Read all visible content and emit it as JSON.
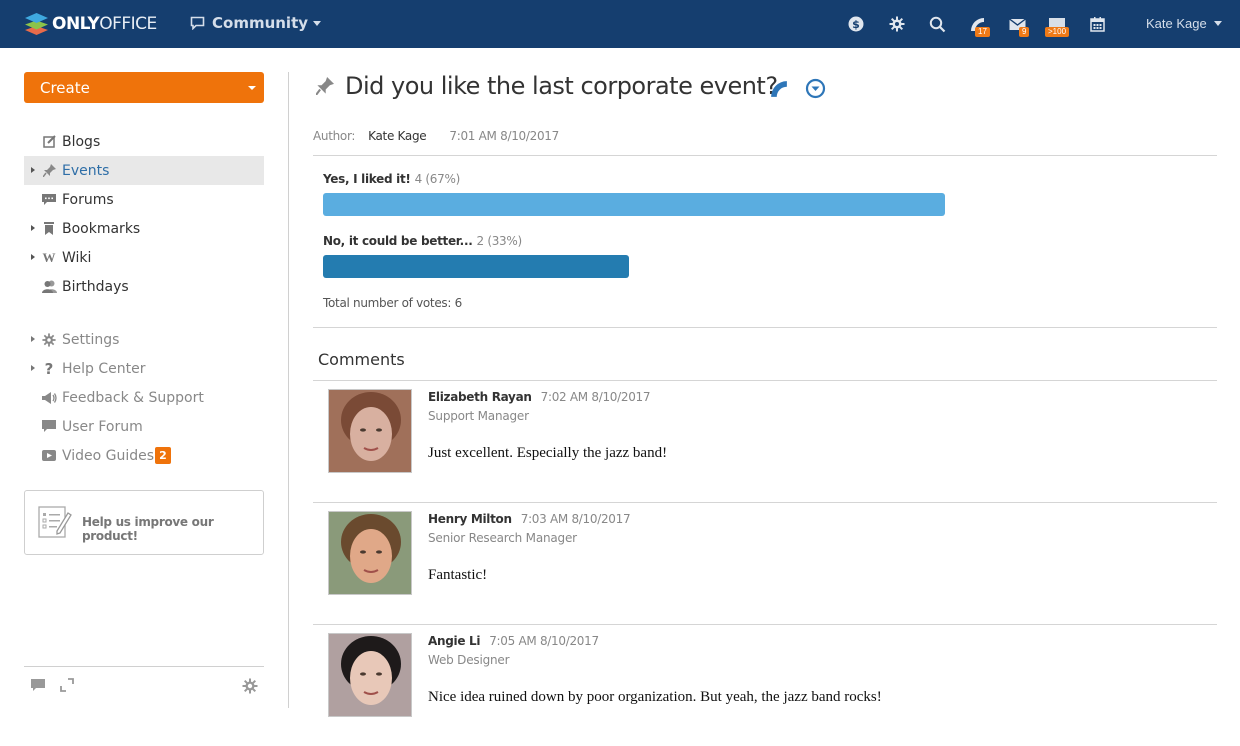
{
  "header": {
    "logo_bold": "ONLY",
    "logo_light": "OFFICE",
    "module_label": "Community",
    "icons": [
      {
        "name": "payments-icon",
        "badge": null
      },
      {
        "name": "settings-icon",
        "badge": null
      },
      {
        "name": "search-icon",
        "badge": null
      },
      {
        "name": "feed-icon",
        "badge": "17"
      },
      {
        "name": "mail-icon",
        "badge": "9"
      },
      {
        "name": "talk-icon",
        "badge": ">100"
      },
      {
        "name": "calendar-icon",
        "badge": null
      }
    ],
    "user_name": "Kate Kage"
  },
  "sidebar": {
    "create_label": "Create",
    "items": [
      {
        "label": "Blogs",
        "icon": "blog-icon",
        "expandable": false,
        "active": false
      },
      {
        "label": "Events",
        "icon": "pin-icon",
        "expandable": true,
        "active": true
      },
      {
        "label": "Forums",
        "icon": "forum-icon",
        "expandable": false,
        "active": false
      },
      {
        "label": "Bookmarks",
        "icon": "bookmark-icon",
        "expandable": true,
        "active": false
      },
      {
        "label": "Wiki",
        "icon": "wiki-icon",
        "expandable": true,
        "active": false
      },
      {
        "label": "Birthdays",
        "icon": "people-icon",
        "expandable": false,
        "active": false
      }
    ],
    "items2": [
      {
        "label": "Settings",
        "icon": "gear-icon",
        "expandable": true
      },
      {
        "label": "Help Center",
        "icon": "question-icon",
        "expandable": true
      },
      {
        "label": "Feedback & Support",
        "icon": "megaphone-icon",
        "expandable": false
      },
      {
        "label": "User Forum",
        "icon": "chat-icon",
        "expandable": false
      },
      {
        "label": "Video Guides",
        "icon": "video-icon",
        "expandable": false,
        "badge": "2"
      }
    ],
    "improve_label": "Help us improve our product!"
  },
  "event": {
    "title": "Did you like the last corporate event?",
    "author_label": "Author:",
    "author": "Kate Kage",
    "time": "7:01 AM 8/10/2017",
    "poll": [
      {
        "answer": "Yes, I liked it!",
        "count_text": "4 (67%)",
        "votes": 4,
        "percent": 67,
        "color": "#5aade0"
      },
      {
        "answer": "No, it could be better...",
        "count_text": "2 (33%)",
        "votes": 2,
        "percent": 33,
        "color": "#247cb0"
      }
    ],
    "total_label": "Total number of votes: 6"
  },
  "comments": {
    "title": "Comments",
    "items": [
      {
        "name": "Elizabeth Rayan",
        "time": "7:02 AM 8/10/2017",
        "role": "Support Manager",
        "text": "Just excellent. Especially the jazz band!",
        "avatar_colors": [
          "#7a4a36",
          "#d8b0a0",
          "#a0705a"
        ]
      },
      {
        "name": "Henry Milton",
        "time": "7:03 AM 8/10/2017",
        "role": "Senior Research Manager",
        "text": "Fantastic!",
        "avatar_colors": [
          "#6a4a2e",
          "#e0a888",
          "#8a9a7a"
        ]
      },
      {
        "name": "Angie Li",
        "time": "7:05 AM 8/10/2017",
        "role": "Web Designer",
        "text": "Nice idea ruined down by poor organization. But yeah, the jazz band rocks!",
        "avatar_colors": [
          "#1e1a1a",
          "#e8c8b8",
          "#b0a0a0"
        ]
      }
    ]
  }
}
